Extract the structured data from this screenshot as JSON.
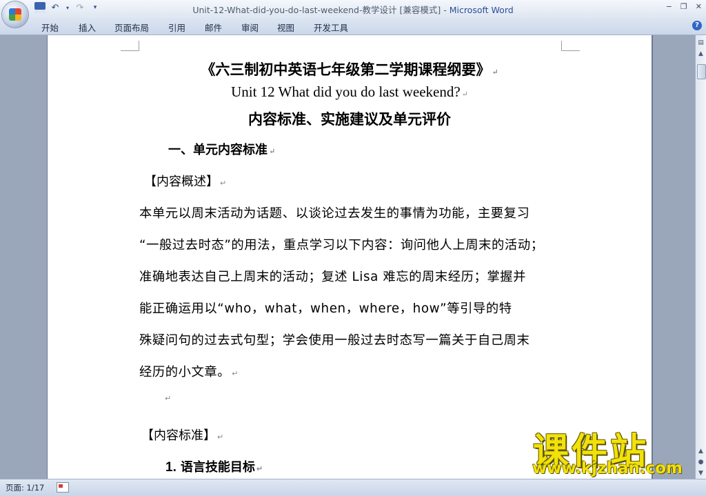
{
  "window": {
    "title": "Unit-12-What-did-you-do-last-weekend-教学设计 [兼容模式]",
    "separator": " - ",
    "app_name": "Microsoft Word",
    "controls": [
      "−",
      "❐",
      "✕"
    ]
  },
  "quick_access": {
    "icons": [
      "save-icon",
      "undo-icon",
      "redo-icon",
      "customize-icon"
    ]
  },
  "ribbon": {
    "tabs": [
      "开始",
      "插入",
      "页面布局",
      "引用",
      "邮件",
      "审阅",
      "视图",
      "开发工具"
    ]
  },
  "document": {
    "title": "《六三制初中英语七年级第二学期课程纲要》",
    "subtitle": "Unit 12 What did you do last weekend?",
    "heading": "内容标准、实施建议及单元评价",
    "section1": "一、单元内容标准",
    "overview_label": "【内容概述】",
    "paragraph_lines": [
      "本单元以周末活动为话题、以谈论过去发生的事情为功能，主要复习",
      "“一般过去时态”的用法，重点学习以下内容：询问他人上周末的活动；",
      "准确地表达自己上周末的活动；复述 Lisa 难忘的周末经历；掌握并",
      "能正确运用以“who，what，when，where，how”等引导的特",
      "殊疑问句的过去式句型；学会使用一般过去时态写一篇关于自己周末",
      "经历的小文章。"
    ],
    "standard_label": "【内容标准】",
    "item1_number": "1.",
    "item1_text": "语言技能目标",
    "paragraph_mark": "↵"
  },
  "status_bar": {
    "page_info": "页面: 1/17"
  },
  "watermark": {
    "site_name": "课件站",
    "url": "www.kjzhan.com"
  },
  "colors": {
    "app_name": "#2b4d96",
    "watermark": "#f2e10a"
  }
}
